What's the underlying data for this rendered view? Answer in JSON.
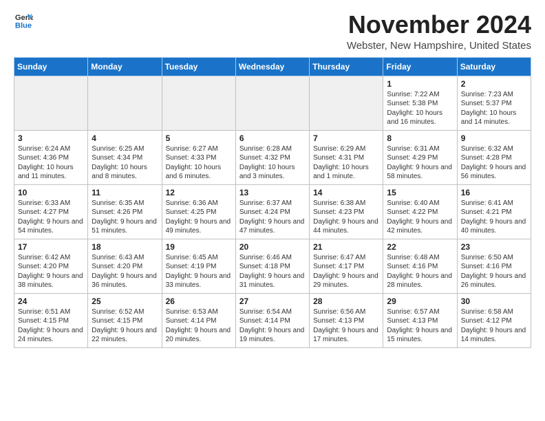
{
  "logo": {
    "general": "General",
    "blue": "Blue"
  },
  "header": {
    "month": "November 2024",
    "location": "Webster, New Hampshire, United States"
  },
  "weekdays": [
    "Sunday",
    "Monday",
    "Tuesday",
    "Wednesday",
    "Thursday",
    "Friday",
    "Saturday"
  ],
  "weeks": [
    [
      {
        "day": "",
        "empty": true
      },
      {
        "day": "",
        "empty": true
      },
      {
        "day": "",
        "empty": true
      },
      {
        "day": "",
        "empty": true
      },
      {
        "day": "",
        "empty": true
      },
      {
        "day": "1",
        "sunrise": "Sunrise: 7:22 AM",
        "sunset": "Sunset: 5:38 PM",
        "daylight": "Daylight: 10 hours and 16 minutes."
      },
      {
        "day": "2",
        "sunrise": "Sunrise: 7:23 AM",
        "sunset": "Sunset: 5:37 PM",
        "daylight": "Daylight: 10 hours and 14 minutes."
      }
    ],
    [
      {
        "day": "3",
        "sunrise": "Sunrise: 6:24 AM",
        "sunset": "Sunset: 4:36 PM",
        "daylight": "Daylight: 10 hours and 11 minutes."
      },
      {
        "day": "4",
        "sunrise": "Sunrise: 6:25 AM",
        "sunset": "Sunset: 4:34 PM",
        "daylight": "Daylight: 10 hours and 8 minutes."
      },
      {
        "day": "5",
        "sunrise": "Sunrise: 6:27 AM",
        "sunset": "Sunset: 4:33 PM",
        "daylight": "Daylight: 10 hours and 6 minutes."
      },
      {
        "day": "6",
        "sunrise": "Sunrise: 6:28 AM",
        "sunset": "Sunset: 4:32 PM",
        "daylight": "Daylight: 10 hours and 3 minutes."
      },
      {
        "day": "7",
        "sunrise": "Sunrise: 6:29 AM",
        "sunset": "Sunset: 4:31 PM",
        "daylight": "Daylight: 10 hours and 1 minute."
      },
      {
        "day": "8",
        "sunrise": "Sunrise: 6:31 AM",
        "sunset": "Sunset: 4:29 PM",
        "daylight": "Daylight: 9 hours and 58 minutes."
      },
      {
        "day": "9",
        "sunrise": "Sunrise: 6:32 AM",
        "sunset": "Sunset: 4:28 PM",
        "daylight": "Daylight: 9 hours and 56 minutes."
      }
    ],
    [
      {
        "day": "10",
        "sunrise": "Sunrise: 6:33 AM",
        "sunset": "Sunset: 4:27 PM",
        "daylight": "Daylight: 9 hours and 54 minutes."
      },
      {
        "day": "11",
        "sunrise": "Sunrise: 6:35 AM",
        "sunset": "Sunset: 4:26 PM",
        "daylight": "Daylight: 9 hours and 51 minutes."
      },
      {
        "day": "12",
        "sunrise": "Sunrise: 6:36 AM",
        "sunset": "Sunset: 4:25 PM",
        "daylight": "Daylight: 9 hours and 49 minutes."
      },
      {
        "day": "13",
        "sunrise": "Sunrise: 6:37 AM",
        "sunset": "Sunset: 4:24 PM",
        "daylight": "Daylight: 9 hours and 47 minutes."
      },
      {
        "day": "14",
        "sunrise": "Sunrise: 6:38 AM",
        "sunset": "Sunset: 4:23 PM",
        "daylight": "Daylight: 9 hours and 44 minutes."
      },
      {
        "day": "15",
        "sunrise": "Sunrise: 6:40 AM",
        "sunset": "Sunset: 4:22 PM",
        "daylight": "Daylight: 9 hours and 42 minutes."
      },
      {
        "day": "16",
        "sunrise": "Sunrise: 6:41 AM",
        "sunset": "Sunset: 4:21 PM",
        "daylight": "Daylight: 9 hours and 40 minutes."
      }
    ],
    [
      {
        "day": "17",
        "sunrise": "Sunrise: 6:42 AM",
        "sunset": "Sunset: 4:20 PM",
        "daylight": "Daylight: 9 hours and 38 minutes."
      },
      {
        "day": "18",
        "sunrise": "Sunrise: 6:43 AM",
        "sunset": "Sunset: 4:20 PM",
        "daylight": "Daylight: 9 hours and 36 minutes."
      },
      {
        "day": "19",
        "sunrise": "Sunrise: 6:45 AM",
        "sunset": "Sunset: 4:19 PM",
        "daylight": "Daylight: 9 hours and 33 minutes."
      },
      {
        "day": "20",
        "sunrise": "Sunrise: 6:46 AM",
        "sunset": "Sunset: 4:18 PM",
        "daylight": "Daylight: 9 hours and 31 minutes."
      },
      {
        "day": "21",
        "sunrise": "Sunrise: 6:47 AM",
        "sunset": "Sunset: 4:17 PM",
        "daylight": "Daylight: 9 hours and 29 minutes."
      },
      {
        "day": "22",
        "sunrise": "Sunrise: 6:48 AM",
        "sunset": "Sunset: 4:16 PM",
        "daylight": "Daylight: 9 hours and 28 minutes."
      },
      {
        "day": "23",
        "sunrise": "Sunrise: 6:50 AM",
        "sunset": "Sunset: 4:16 PM",
        "daylight": "Daylight: 9 hours and 26 minutes."
      }
    ],
    [
      {
        "day": "24",
        "sunrise": "Sunrise: 6:51 AM",
        "sunset": "Sunset: 4:15 PM",
        "daylight": "Daylight: 9 hours and 24 minutes."
      },
      {
        "day": "25",
        "sunrise": "Sunrise: 6:52 AM",
        "sunset": "Sunset: 4:15 PM",
        "daylight": "Daylight: 9 hours and 22 minutes."
      },
      {
        "day": "26",
        "sunrise": "Sunrise: 6:53 AM",
        "sunset": "Sunset: 4:14 PM",
        "daylight": "Daylight: 9 hours and 20 minutes."
      },
      {
        "day": "27",
        "sunrise": "Sunrise: 6:54 AM",
        "sunset": "Sunset: 4:14 PM",
        "daylight": "Daylight: 9 hours and 19 minutes."
      },
      {
        "day": "28",
        "sunrise": "Sunrise: 6:56 AM",
        "sunset": "Sunset: 4:13 PM",
        "daylight": "Daylight: 9 hours and 17 minutes."
      },
      {
        "day": "29",
        "sunrise": "Sunrise: 6:57 AM",
        "sunset": "Sunset: 4:13 PM",
        "daylight": "Daylight: 9 hours and 15 minutes."
      },
      {
        "day": "30",
        "sunrise": "Sunrise: 6:58 AM",
        "sunset": "Sunset: 4:12 PM",
        "daylight": "Daylight: 9 hours and 14 minutes."
      }
    ]
  ]
}
